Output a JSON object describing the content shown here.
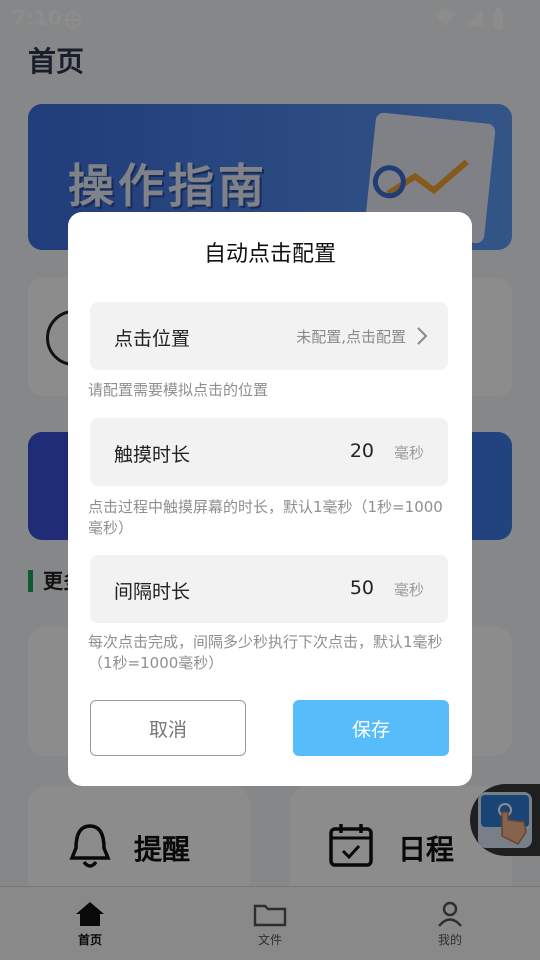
{
  "status_bar": {
    "time": "7:10",
    "bug_icon": "bug-icon"
  },
  "home": {
    "page_title": "首页",
    "banner_text": "操作指南",
    "section_label": "更多",
    "tiles": [
      {
        "label": "提醒",
        "icon": "bell-icon"
      },
      {
        "label": "日程",
        "icon": "calendar-icon"
      }
    ]
  },
  "tabbar": {
    "items": [
      {
        "label": "首页",
        "icon": "home-icon",
        "active": true
      },
      {
        "label": "文件",
        "icon": "folder-icon",
        "active": false
      },
      {
        "label": "我的",
        "icon": "person-icon",
        "active": false
      }
    ]
  },
  "dialog": {
    "title": "自动点击配置",
    "position": {
      "label": "点击位置",
      "value": "未配置,点击配置",
      "hint": "请配置需要模拟点击的位置"
    },
    "touch_duration": {
      "label": "触摸时长",
      "value": "20",
      "unit": "毫秒",
      "hint": "点击过程中触摸屏幕的时长，默认1毫秒（1秒=1000毫秒）"
    },
    "interval": {
      "label": "间隔时长",
      "value": "50",
      "unit": "毫秒",
      "hint": "每次点击完成，间隔多少秒执行下次点击，默认1毫秒（1秒=1000毫秒）"
    },
    "cancel_label": "取消",
    "save_label": "保存"
  },
  "colors": {
    "save_button": "#56bdfa",
    "section_accent": "#1aa260"
  }
}
